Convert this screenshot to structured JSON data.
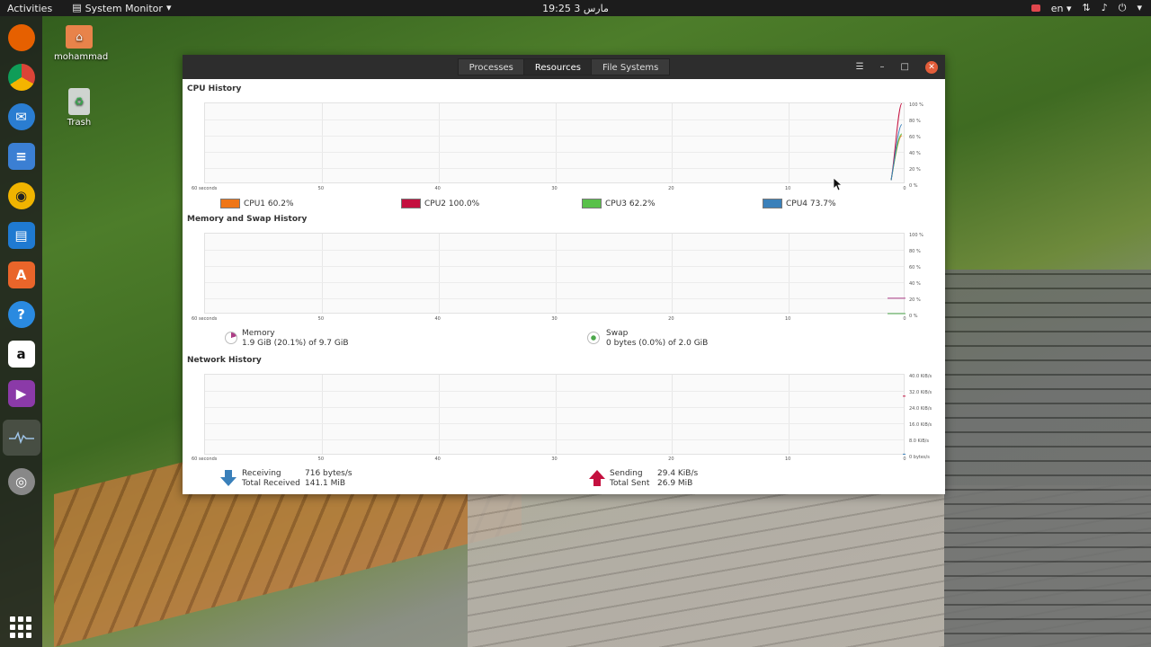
{
  "topbar": {
    "activities": "Activities",
    "app_name": "System Monitor",
    "clock": "19:25  مارس 3",
    "language": "en"
  },
  "dock": {
    "items": [
      "firefox-icon",
      "chrome-icon",
      "thunderbird-icon",
      "files-icon",
      "rhythmbox-icon",
      "writer-icon",
      "software-icon",
      "help-icon",
      "amazon-icon",
      "video-icon",
      "system-monitor-icon",
      "dvd-icon"
    ]
  },
  "desktop": {
    "home_label": "mohammad",
    "trash_label": "Trash"
  },
  "window": {
    "tabs": [
      "Processes",
      "Resources",
      "File Systems"
    ],
    "active_tab": "Resources",
    "cpu": {
      "title": "CPU History",
      "x_ticks": [
        "60 seconds",
        "50",
        "40",
        "30",
        "20",
        "10",
        "0"
      ],
      "y_ticks": [
        "100 %",
        "80 %",
        "60 %",
        "40 %",
        "20 %",
        "0 %"
      ],
      "legend": [
        {
          "label": "CPU1",
          "value": "60.2%",
          "color": "#ef7617"
        },
        {
          "label": "CPU2",
          "value": "100.0%",
          "color": "#c4103f"
        },
        {
          "label": "CPU3",
          "value": "62.2%",
          "color": "#59c14a"
        },
        {
          "label": "CPU4",
          "value": "73.7%",
          "color": "#3a80ba"
        }
      ]
    },
    "memory": {
      "title": "Memory and Swap History",
      "x_ticks": [
        "60 seconds",
        "50",
        "40",
        "30",
        "20",
        "10",
        "0"
      ],
      "y_ticks": [
        "100 %",
        "80 %",
        "60 %",
        "40 %",
        "20 %",
        "0 %"
      ],
      "memory_label": "Memory",
      "memory_value": "1.9 GiB (20.1%) of 9.7 GiB",
      "memory_color": "#ad3d86",
      "swap_label": "Swap",
      "swap_value": "0 bytes (0.0%) of 2.0 GiB",
      "swap_color": "#4ca74b"
    },
    "network": {
      "title": "Network History",
      "x_ticks": [
        "60 seconds",
        "50",
        "40",
        "30",
        "20",
        "10",
        "0"
      ],
      "y_ticks": [
        "40.0 KiB/s",
        "32.0 KiB/s",
        "24.0 KiB/s",
        "16.0 KiB/s",
        "8.0 KiB/s",
        "0 bytes/s"
      ],
      "receiving_label": "Receiving",
      "receiving_value": "716 bytes/s",
      "total_received_label": "Total Received",
      "total_received_value": "141.1 MiB",
      "sending_label": "Sending",
      "sending_value": "29.4 KiB/s",
      "total_sent_label": "Total Sent",
      "total_sent_value": "26.9 MiB",
      "receiving_color": "#3a80ba",
      "sending_color": "#c4103f"
    }
  }
}
